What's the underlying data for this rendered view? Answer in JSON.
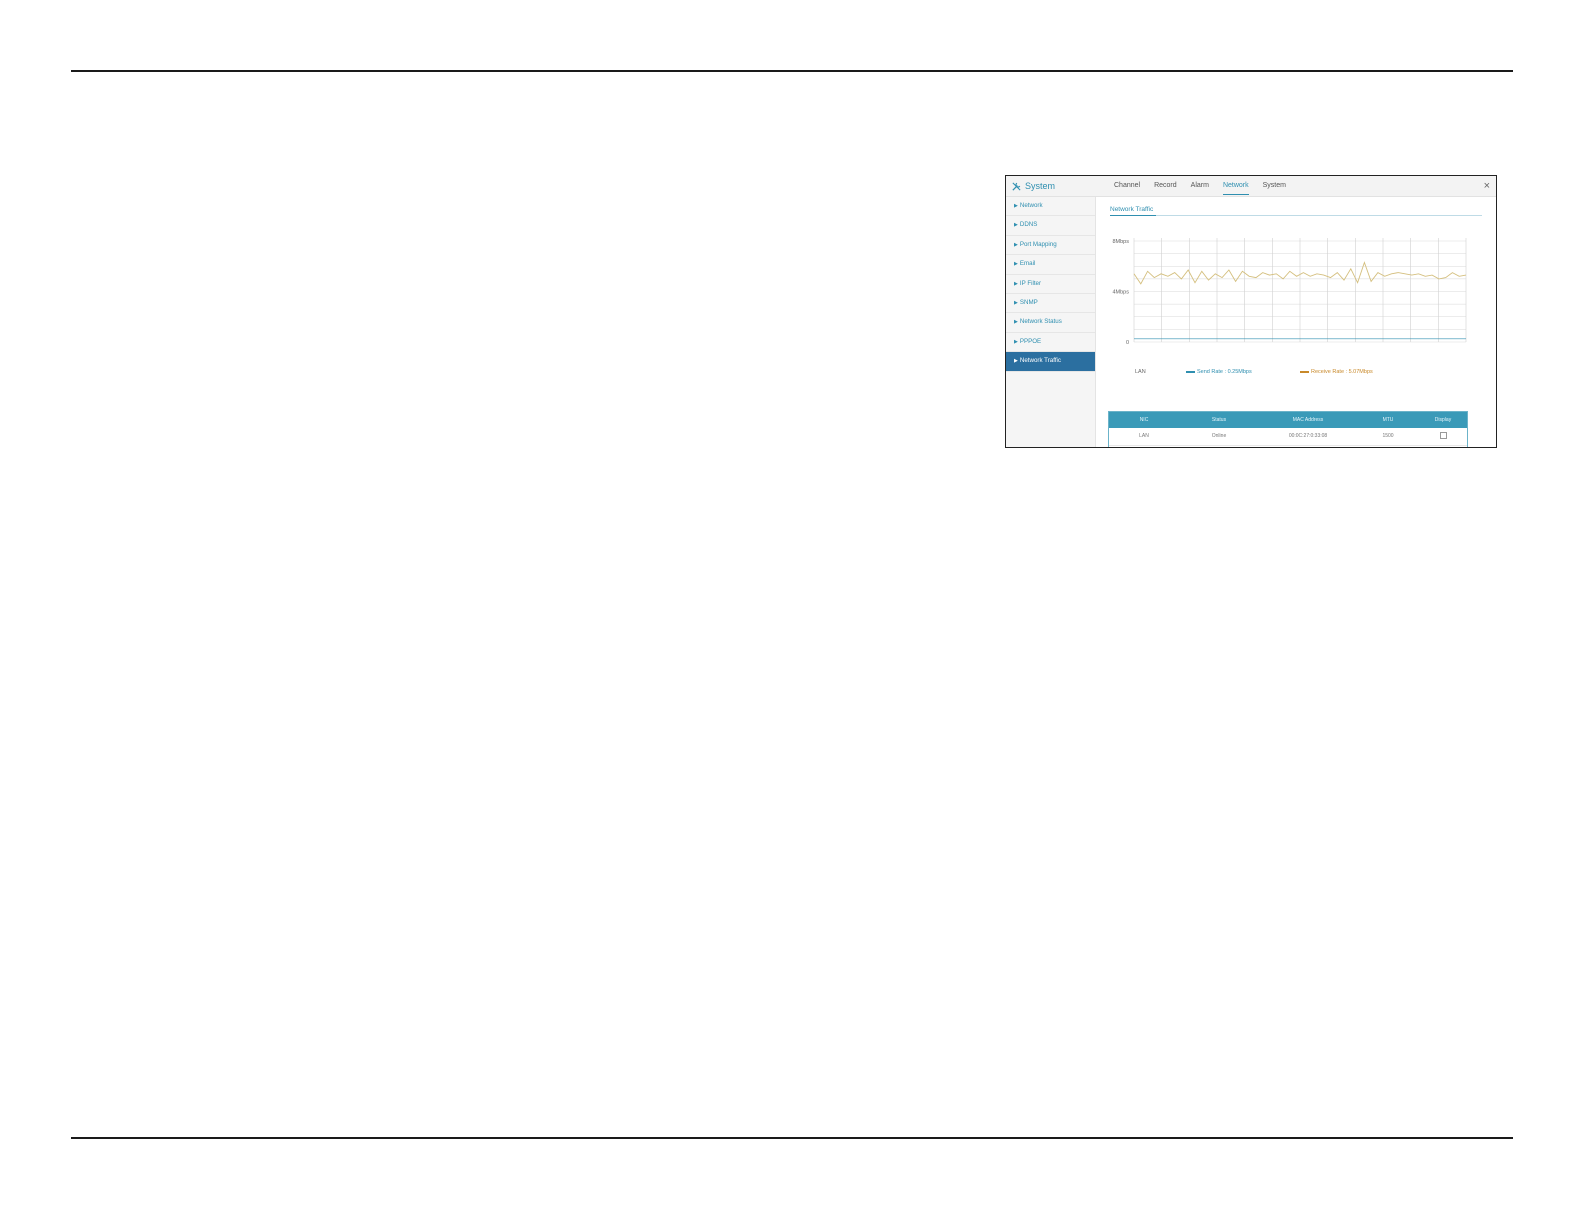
{
  "window": {
    "title": "System",
    "close_glyph": "×",
    "icon": "wrench-icon"
  },
  "tabs": [
    {
      "label": "Channel",
      "active": false
    },
    {
      "label": "Record",
      "active": false
    },
    {
      "label": "Alarm",
      "active": false
    },
    {
      "label": "Network",
      "active": true
    },
    {
      "label": "System",
      "active": false
    }
  ],
  "sidebar": {
    "items": [
      {
        "label": "Network",
        "active": false
      },
      {
        "label": "DDNS",
        "active": false
      },
      {
        "label": "Port Mapping",
        "active": false
      },
      {
        "label": "Email",
        "active": false
      },
      {
        "label": "IP Filter",
        "active": false
      },
      {
        "label": "SNMP",
        "active": false
      },
      {
        "label": "Network Status",
        "active": false
      },
      {
        "label": "PPPOE",
        "active": false
      },
      {
        "label": "Network Traffic",
        "active": true
      }
    ]
  },
  "main": {
    "section_title": "Network Traffic",
    "legend": {
      "nic": "LAN",
      "send": "Send Rate : 0.25Mbps",
      "receive": "Receive Rate : 5.07Mbps"
    },
    "table": {
      "headers": [
        "NIC",
        "Status",
        "MAC Address",
        "MTU",
        "Display"
      ],
      "rows": [
        {
          "nic": "LAN",
          "status": "Online",
          "mac": "00:0C:27:0:33:08",
          "mtu": "1500",
          "display": true
        }
      ]
    }
  },
  "chart_data": {
    "type": "line",
    "ytick_labels": [
      "8Mbps",
      "4Mbps",
      "0"
    ],
    "ylim": [
      0,
      8
    ],
    "grid": true,
    "series": [
      {
        "name": "Receive Rate : 5.07Mbps",
        "color": "#d4bf7e",
        "values": [
          5.4,
          4.6,
          5.6,
          5.1,
          5.4,
          5.2,
          5.5,
          5.0,
          5.7,
          4.7,
          5.6,
          4.9,
          5.4,
          5.1,
          5.7,
          4.8,
          5.6,
          5.2,
          5.1,
          5.5,
          5.3,
          5.4,
          5.0,
          5.6,
          5.2,
          5.5,
          5.2,
          5.4,
          5.3,
          5.1,
          5.5,
          4.9,
          5.8,
          4.7,
          6.3,
          4.8,
          5.5,
          5.2,
          5.4,
          5.5,
          5.4,
          5.3,
          5.4,
          5.2,
          5.3,
          5.0,
          5.1,
          5.5,
          5.2,
          5.3
        ]
      },
      {
        "name": "Send Rate : 0.25Mbps",
        "color": "#2f8fb0",
        "values": [
          0.25,
          0.25,
          0.25,
          0.25,
          0.25,
          0.25,
          0.25,
          0.25,
          0.25,
          0.25,
          0.25,
          0.25,
          0.25,
          0.25,
          0.25,
          0.25,
          0.25,
          0.25,
          0.25,
          0.25,
          0.25,
          0.25,
          0.25,
          0.25,
          0.25,
          0.25,
          0.25,
          0.25,
          0.25,
          0.25,
          0.25,
          0.25,
          0.25,
          0.25,
          0.25,
          0.25,
          0.25,
          0.25,
          0.25,
          0.25,
          0.25,
          0.25,
          0.25,
          0.25,
          0.25,
          0.25,
          0.25,
          0.25,
          0.25,
          0.25
        ]
      }
    ]
  }
}
